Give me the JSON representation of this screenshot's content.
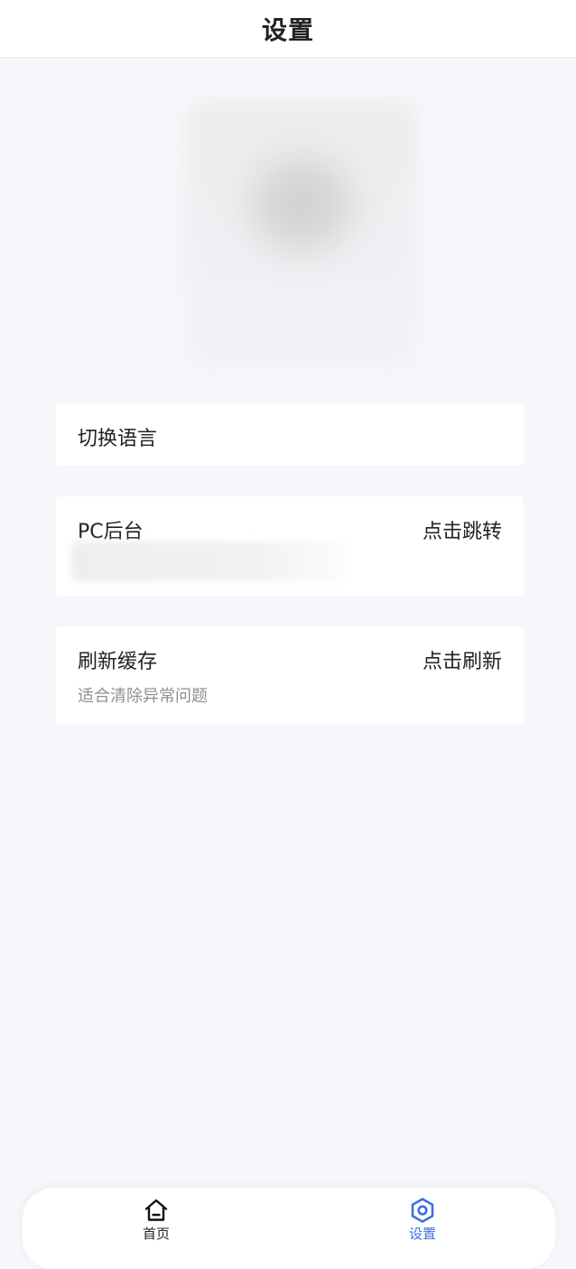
{
  "header": {
    "title": "设置"
  },
  "settings": {
    "language": {
      "title": "切换语言"
    },
    "pc_backend": {
      "title": "PC后台",
      "action": "点击跳转"
    },
    "cache": {
      "title": "刷新缓存",
      "action": "点击刷新",
      "subtitle": "适合清除异常问题"
    }
  },
  "tabbar": {
    "tabs": [
      {
        "label": "首页",
        "icon": "home-icon",
        "active": false
      },
      {
        "label": "设置",
        "icon": "settings-icon",
        "active": true
      }
    ],
    "active_color": "#3c6fe0",
    "inactive_color": "#222222"
  }
}
